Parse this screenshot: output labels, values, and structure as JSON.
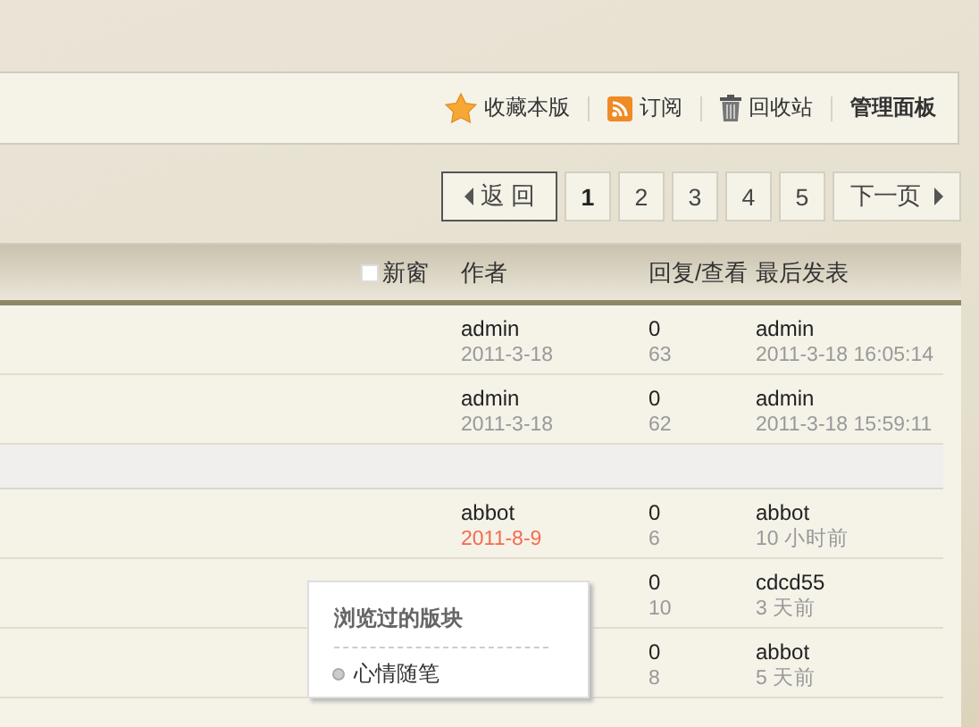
{
  "toolbar": {
    "items": [
      {
        "kind": "star",
        "label": "收藏本版"
      },
      {
        "kind": "rss",
        "label": "订阅"
      },
      {
        "kind": "trash",
        "label": "回收站"
      },
      {
        "kind": "plain",
        "label": "管理面板"
      }
    ]
  },
  "pager": {
    "back": "返 回",
    "pages": [
      {
        "label": "1",
        "selected": true
      },
      {
        "label": "2",
        "selected": false
      },
      {
        "label": "3",
        "selected": false
      },
      {
        "label": "4",
        "selected": false
      },
      {
        "label": "5",
        "selected": false
      }
    ],
    "next": "下一页"
  },
  "table": {
    "new_window": {
      "label": "新窗",
      "checked": false
    },
    "columns": [
      "作者",
      "回复/查看",
      "最后发表"
    ],
    "rows": [
      {
        "kind": "thread",
        "author": "admin",
        "date": "2011-3-18",
        "highlighted": false,
        "replies": "0",
        "views": "63",
        "last_author": "admin",
        "last_time": "2011-3-18 16:05:14"
      },
      {
        "kind": "thread",
        "author": "admin",
        "date": "2011-3-18",
        "highlighted": false,
        "replies": "0",
        "views": "62",
        "last_author": "admin",
        "last_time": "2011-3-18 15:59:11"
      },
      {
        "kind": "separator"
      },
      {
        "kind": "thread",
        "author": "abbot",
        "date": "2011-8-9",
        "highlighted": true,
        "replies": "0",
        "views": "6",
        "last_author": "abbot",
        "last_time": "10 小时前"
      },
      {
        "kind": "thread",
        "replies": "0",
        "views": "10",
        "last_author": "cdcd55",
        "last_time": "3 天前"
      },
      {
        "kind": "thread",
        "replies": "0",
        "views": "8",
        "last_author": "abbot",
        "last_time": "5 天前"
      }
    ]
  },
  "popup": {
    "title": "浏览过的版块",
    "items": [
      "心情随笔"
    ]
  }
}
